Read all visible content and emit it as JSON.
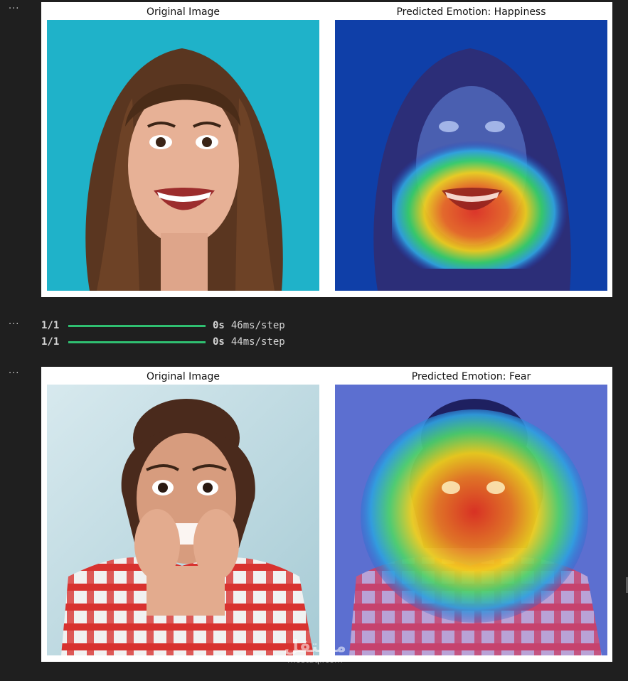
{
  "cells": [
    {
      "gutter": "···",
      "figure": {
        "left_title": "Original Image",
        "right_title": "Predicted Emotion: Happiness",
        "left_image": "photo of smiling woman with long brown hair on teal background",
        "right_image": "grad-cam heatmap overlay on smiling woman"
      }
    },
    {
      "gutter": "···",
      "progress": [
        {
          "step": "1/1",
          "fill": 1.0,
          "elapsed": "0s",
          "rate": "46ms/step"
        },
        {
          "step": "1/1",
          "fill": 1.0,
          "elapsed": "0s",
          "rate": "44ms/step"
        }
      ]
    },
    {
      "gutter": "···",
      "figure": {
        "left_title": "Original Image",
        "right_title": "Predicted Emotion: Fear",
        "left_image": "photo of frightened woman in red plaid shirt biting fingers",
        "right_image": "grad-cam heatmap overlay on frightened woman"
      }
    }
  ],
  "watermark": {
    "main": "مستقل",
    "sub": "mostaql.com"
  },
  "colors": {
    "background": "#1f1f1f",
    "progress_fill": "#2fbf71",
    "heat_red": "#e8331f",
    "heat_yellow": "#f5d31a",
    "heat_blue": "#1f3fbf"
  }
}
